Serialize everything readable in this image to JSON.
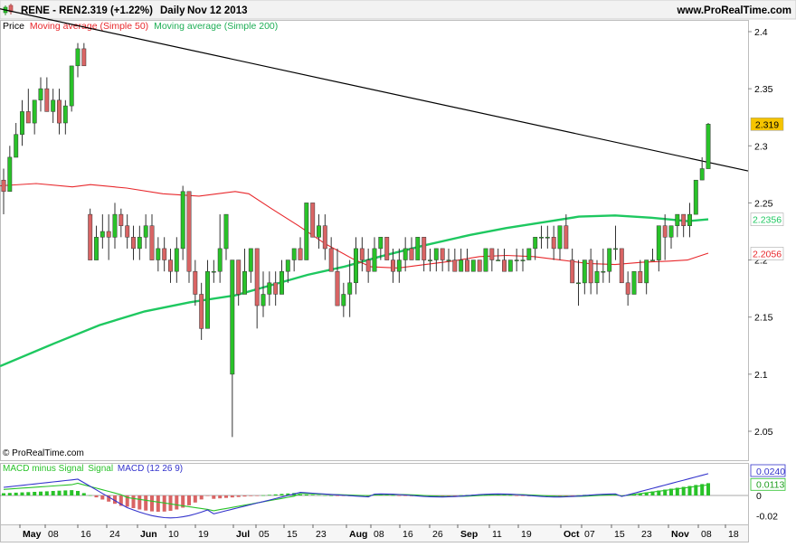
{
  "header": {
    "ticker": "RENE - REN",
    "price_change": "2.319 (+1.22%)",
    "period": "Daily",
    "date": "Nov 12 2013",
    "site": "www.ProRealTime.com"
  },
  "legend": {
    "price": "Price",
    "ma50": "Moving average (Simple 50)",
    "ma200": "Moving average (Simple 200)"
  },
  "macd_legend": {
    "hist": "MACD minus Signal",
    "signal": "Signal",
    "macd": "MACD (12 26 9)"
  },
  "watermark": "© ProRealTime.com",
  "colors": {
    "up": "#29c229",
    "down": "#d96464",
    "ma50": "#e8282c",
    "ma200": "#1ec860",
    "trendline": "#000000",
    "macd": "#3333cc",
    "signal": "#29c229",
    "price_badge": "#f5c400",
    "ma200_badge": "#1ec860",
    "ma50_badge": "#e8282c",
    "macd_badge": "#3333cc",
    "signal_badge": "#29c229"
  },
  "chart_data": {
    "type": "candlestick",
    "y_ticks": [
      "2.4",
      "2.35",
      "2.3",
      "2.25",
      "2.2",
      "2.15",
      "2.1",
      "2.05"
    ],
    "ylim": [
      2.04,
      2.41
    ],
    "x_ticks": [
      "May",
      "08",
      "16",
      "24",
      "Jun",
      "10",
      "19",
      "Jul",
      "05",
      "15",
      "23",
      "Aug",
      "08",
      "16",
      "26",
      "Sep",
      "11",
      "19",
      "Oct",
      "07",
      "15",
      "23",
      "Nov",
      "08",
      "18"
    ],
    "last_price": "2.319",
    "ma200_last": "2.2356",
    "ma50_last": "2.2056",
    "candles": [
      [
        2.27,
        2.28,
        2.24,
        2.26
      ],
      [
        2.26,
        2.3,
        2.26,
        2.29
      ],
      [
        2.29,
        2.32,
        2.29,
        2.31
      ],
      [
        2.31,
        2.34,
        2.3,
        2.33
      ],
      [
        2.33,
        2.35,
        2.32,
        2.32
      ],
      [
        2.32,
        2.34,
        2.31,
        2.34
      ],
      [
        2.34,
        2.36,
        2.33,
        2.35
      ],
      [
        2.35,
        2.36,
        2.33,
        2.33
      ],
      [
        2.33,
        2.35,
        2.32,
        2.34
      ],
      [
        2.34,
        2.35,
        2.31,
        2.32
      ],
      [
        2.32,
        2.34,
        2.31,
        2.335
      ],
      [
        2.335,
        2.37,
        2.33,
        2.37
      ],
      [
        2.37,
        2.39,
        2.36,
        2.385
      ],
      [
        2.385,
        2.39,
        2.37,
        2.37
      ],
      [
        2.24,
        2.245,
        2.2,
        2.2
      ],
      [
        2.2,
        2.23,
        2.2,
        2.22
      ],
      [
        2.22,
        2.24,
        2.21,
        2.225
      ],
      [
        2.225,
        2.24,
        2.2,
        2.22
      ],
      [
        2.22,
        2.25,
        2.21,
        2.24
      ],
      [
        2.24,
        2.245,
        2.22,
        2.23
      ],
      [
        2.23,
        2.24,
        2.21,
        2.22
      ],
      [
        2.22,
        2.23,
        2.2,
        2.21
      ],
      [
        2.21,
        2.23,
        2.2,
        2.22
      ],
      [
        2.22,
        2.24,
        2.21,
        2.23
      ],
      [
        2.23,
        2.24,
        2.2,
        2.2
      ],
      [
        2.2,
        2.22,
        2.19,
        2.21
      ],
      [
        2.21,
        2.22,
        2.19,
        2.2
      ],
      [
        2.2,
        2.21,
        2.18,
        2.19
      ],
      [
        2.19,
        2.22,
        2.18,
        2.21
      ],
      [
        2.21,
        2.265,
        2.2,
        2.26
      ],
      [
        2.26,
        2.26,
        2.18,
        2.19
      ],
      [
        2.19,
        2.2,
        2.16,
        2.17
      ],
      [
        2.17,
        2.18,
        2.13,
        2.14
      ],
      [
        2.14,
        2.2,
        2.14,
        2.19
      ],
      [
        2.19,
        2.2,
        2.18,
        2.19
      ],
      [
        2.19,
        2.24,
        2.18,
        2.21
      ],
      [
        2.21,
        2.24,
        2.2,
        2.24
      ],
      [
        2.1,
        2.2,
        2.045,
        2.2
      ],
      [
        2.2,
        2.2,
        2.16,
        2.17
      ],
      [
        2.17,
        2.21,
        2.17,
        2.19
      ],
      [
        2.19,
        2.21,
        2.18,
        2.21
      ],
      [
        2.21,
        2.21,
        2.14,
        2.16
      ],
      [
        2.16,
        2.19,
        2.15,
        2.17
      ],
      [
        2.17,
        2.19,
        2.16,
        2.18
      ],
      [
        2.18,
        2.19,
        2.16,
        2.17
      ],
      [
        2.17,
        2.2,
        2.17,
        2.19
      ],
      [
        2.19,
        2.2,
        2.18,
        2.2
      ],
      [
        2.2,
        2.21,
        2.19,
        2.21
      ],
      [
        2.21,
        2.22,
        2.2,
        2.2
      ],
      [
        2.2,
        2.25,
        2.2,
        2.25
      ],
      [
        2.25,
        2.25,
        2.22,
        2.22
      ],
      [
        2.22,
        2.24,
        2.21,
        2.23
      ],
      [
        2.23,
        2.24,
        2.2,
        2.21
      ],
      [
        2.21,
        2.22,
        2.19,
        2.19
      ],
      [
        2.19,
        2.21,
        2.16,
        2.16
      ],
      [
        2.16,
        2.18,
        2.15,
        2.17
      ],
      [
        2.17,
        2.2,
        2.15,
        2.18
      ],
      [
        2.18,
        2.22,
        2.17,
        2.21
      ],
      [
        2.21,
        2.22,
        2.19,
        2.2
      ],
      [
        2.2,
        2.21,
        2.18,
        2.19
      ],
      [
        2.19,
        2.22,
        2.19,
        2.21
      ],
      [
        2.21,
        2.22,
        2.2,
        2.22
      ],
      [
        2.22,
        2.22,
        2.2,
        2.2
      ],
      [
        2.2,
        2.21,
        2.18,
        2.19
      ],
      [
        2.19,
        2.21,
        2.18,
        2.2
      ],
      [
        2.2,
        2.22,
        2.19,
        2.21
      ],
      [
        2.21,
        2.22,
        2.2,
        2.2
      ],
      [
        2.2,
        2.22,
        2.2,
        2.22
      ],
      [
        2.22,
        2.22,
        2.19,
        2.2
      ],
      [
        2.2,
        2.21,
        2.19,
        2.2
      ],
      [
        2.2,
        2.21,
        2.19,
        2.21
      ],
      [
        2.21,
        2.21,
        2.19,
        2.2
      ],
      [
        2.2,
        2.21,
        2.19,
        2.2
      ],
      [
        2.2,
        2.21,
        2.19,
        2.19
      ],
      [
        2.19,
        2.21,
        2.19,
        2.2
      ],
      [
        2.2,
        2.21,
        2.19,
        2.19
      ],
      [
        2.19,
        2.2,
        2.19,
        2.2
      ],
      [
        2.2,
        2.2,
        2.19,
        2.19
      ],
      [
        2.19,
        2.21,
        2.19,
        2.21
      ],
      [
        2.21,
        2.21,
        2.19,
        2.2
      ],
      [
        2.2,
        2.21,
        2.2,
        2.2
      ],
      [
        2.2,
        2.21,
        2.19,
        2.19
      ],
      [
        2.19,
        2.2,
        2.19,
        2.2
      ],
      [
        2.2,
        2.21,
        2.19,
        2.2
      ],
      [
        2.2,
        2.21,
        2.19,
        2.2
      ],
      [
        2.2,
        2.21,
        2.2,
        2.21
      ],
      [
        2.21,
        2.22,
        2.2,
        2.22
      ],
      [
        2.22,
        2.23,
        2.21,
        2.22
      ],
      [
        2.22,
        2.23,
        2.21,
        2.22
      ],
      [
        2.22,
        2.23,
        2.2,
        2.21
      ],
      [
        2.21,
        2.23,
        2.2,
        2.23
      ],
      [
        2.23,
        2.24,
        2.21,
        2.21
      ],
      [
        2.2,
        2.21,
        2.18,
        2.18
      ],
      [
        2.18,
        2.2,
        2.16,
        2.18
      ],
      [
        2.18,
        2.2,
        2.17,
        2.2
      ],
      [
        2.2,
        2.21,
        2.17,
        2.18
      ],
      [
        2.18,
        2.2,
        2.17,
        2.19
      ],
      [
        2.19,
        2.21,
        2.18,
        2.19
      ],
      [
        2.19,
        2.21,
        2.18,
        2.21
      ],
      [
        2.21,
        2.23,
        2.2,
        2.21
      ],
      [
        2.21,
        2.21,
        2.18,
        2.18
      ],
      [
        2.18,
        2.19,
        2.16,
        2.17
      ],
      [
        2.17,
        2.19,
        2.17,
        2.19
      ],
      [
        2.19,
        2.2,
        2.18,
        2.18
      ],
      [
        2.18,
        2.2,
        2.17,
        2.2
      ],
      [
        2.2,
        2.21,
        2.2,
        2.2
      ],
      [
        2.2,
        2.23,
        2.19,
        2.23
      ],
      [
        2.23,
        2.24,
        2.2,
        2.22
      ],
      [
        2.22,
        2.23,
        2.21,
        2.23
      ],
      [
        2.23,
        2.24,
        2.22,
        2.24
      ],
      [
        2.24,
        2.24,
        2.22,
        2.23
      ],
      [
        2.23,
        2.25,
        2.22,
        2.24
      ],
      [
        2.24,
        2.27,
        2.24,
        2.27
      ],
      [
        2.27,
        2.29,
        2.27,
        2.28
      ],
      [
        2.28,
        2.32,
        2.28,
        2.319
      ]
    ],
    "ma50": [
      [
        0,
        2.265
      ],
      [
        40,
        2.267
      ],
      [
        80,
        2.264
      ],
      [
        100,
        2.266
      ],
      [
        140,
        2.263
      ],
      [
        180,
        2.258
      ],
      [
        220,
        2.256
      ],
      [
        260,
        2.26
      ],
      [
        275,
        2.258
      ],
      [
        300,
        2.245
      ],
      [
        330,
        2.23
      ],
      [
        360,
        2.214
      ],
      [
        390,
        2.201
      ],
      [
        410,
        2.194
      ],
      [
        440,
        2.193
      ],
      [
        470,
        2.196
      ],
      [
        500,
        2.199
      ],
      [
        530,
        2.203
      ],
      [
        560,
        2.204
      ],
      [
        590,
        2.203
      ],
      [
        620,
        2.2
      ],
      [
        650,
        2.197
      ],
      [
        680,
        2.196
      ],
      [
        710,
        2.198
      ],
      [
        740,
        2.199
      ],
      [
        760,
        2.2
      ],
      [
        783,
        2.206
      ]
    ],
    "ma200": [
      [
        0,
        2.107
      ],
      [
        60,
        2.127
      ],
      [
        110,
        2.143
      ],
      [
        160,
        2.155
      ],
      [
        210,
        2.163
      ],
      [
        260,
        2.169
      ],
      [
        300,
        2.178
      ],
      [
        340,
        2.187
      ],
      [
        380,
        2.194
      ],
      [
        420,
        2.203
      ],
      [
        470,
        2.213
      ],
      [
        520,
        2.222
      ],
      [
        560,
        2.228
      ],
      [
        600,
        2.233
      ],
      [
        640,
        2.238
      ],
      [
        680,
        2.239
      ],
      [
        720,
        2.237
      ],
      [
        760,
        2.234
      ],
      [
        783,
        2.2356
      ]
    ],
    "trendline": [
      [
        0,
        2.42
      ],
      [
        827,
        2.278
      ]
    ],
    "macd_panel": {
      "y_ticks": [
        "0.0240",
        "0.0113",
        "0",
        "-0.02"
      ],
      "ylim": [
        -0.027,
        0.03
      ]
    }
  }
}
